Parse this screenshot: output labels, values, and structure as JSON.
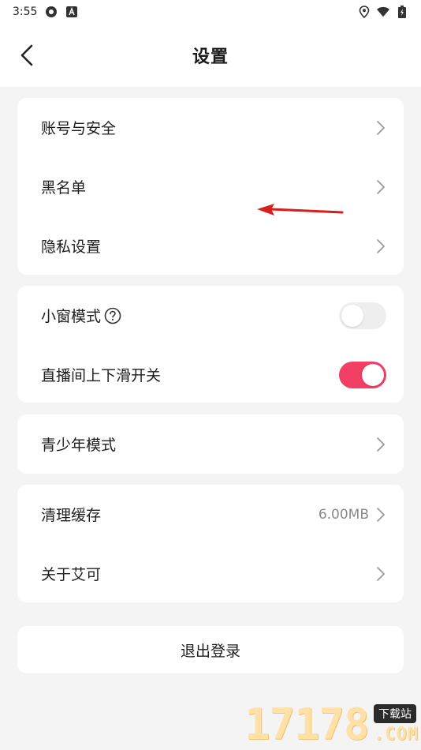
{
  "status_bar": {
    "time": "3:55",
    "icons_left": [
      "vpn-shield-icon",
      "notification-a-icon"
    ],
    "icons_right": [
      "location-icon",
      "wifi-icon",
      "battery-icon"
    ]
  },
  "header": {
    "title": "设置",
    "back_icon": "chevron-left-icon"
  },
  "cards": {
    "account": {
      "items": [
        {
          "label": "账号与安全"
        },
        {
          "label": "黑名单"
        },
        {
          "label": "隐私设置"
        }
      ]
    },
    "playback": {
      "small_window": {
        "label": "小窗模式",
        "toggle_on": false
      },
      "live_swipe": {
        "label": "直播间上下滑开关",
        "toggle_on": true
      }
    },
    "youth": {
      "items": [
        {
          "label": "青少年模式"
        }
      ]
    },
    "about": {
      "clear_cache": {
        "label": "清理缓存",
        "value": "6.00MB"
      },
      "about_app": {
        "label": "关于艾可"
      }
    }
  },
  "logout": {
    "label": "退出登录"
  },
  "watermark": {
    "digits": "17178",
    "badge": "下载站",
    "suffix": ".COM"
  },
  "colors": {
    "accent": "#f23f64",
    "background": "#f4f4f4",
    "card": "#ffffff",
    "annotation_arrow": "#d81e1e"
  }
}
